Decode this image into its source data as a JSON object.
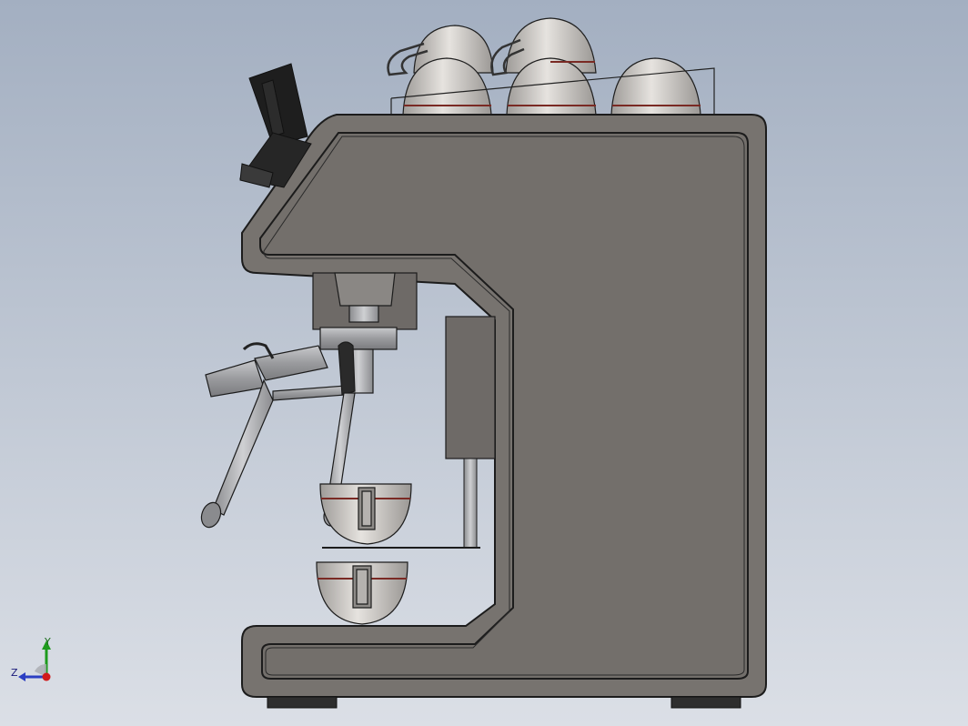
{
  "viewport": {
    "background_top": "#a4b0c2",
    "background_bottom": "#d9dde4",
    "body_color": "#77736f",
    "edge_color": "#1c1c1c",
    "metal_color": "#a9aaad",
    "cup_color": "#d6d3cf",
    "cup_stripe_color": "#7a2a24",
    "foot_color": "#2e2e2e",
    "grinder_color": "#1e1e1e"
  },
  "triad": {
    "y_label": "Y",
    "z_label": "Z",
    "y_color": "#1e9b1e",
    "z_color": "#2b3ec2",
    "x_color": "#d11a1a"
  }
}
